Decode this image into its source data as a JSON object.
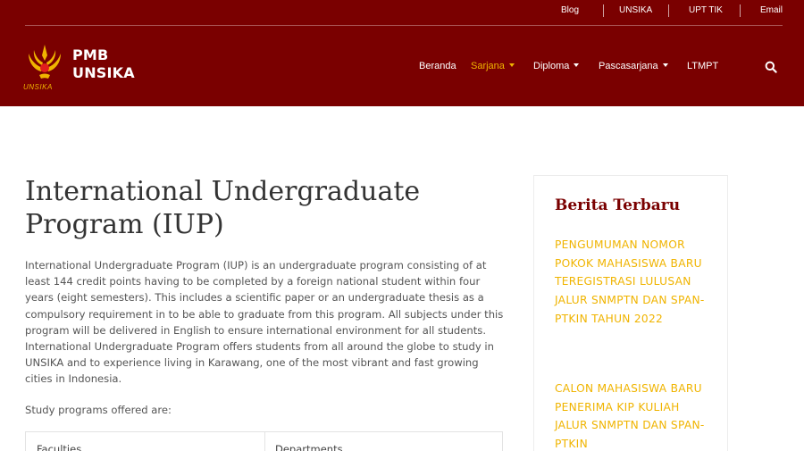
{
  "topbar": {
    "links": [
      "Blog",
      "UNSIKA",
      "UPT TIK",
      "Email"
    ]
  },
  "logo": {
    "line1": "PMB",
    "line2": "UNSIKA",
    "subtext": "UNSIKA"
  },
  "nav": {
    "items": [
      {
        "label": "Beranda",
        "dropdown": false,
        "active": false
      },
      {
        "label": "Sarjana",
        "dropdown": true,
        "active": true
      },
      {
        "label": "Diploma",
        "dropdown": true,
        "active": false
      },
      {
        "label": "Pascasarjana",
        "dropdown": true,
        "active": false
      },
      {
        "label": "LTMPT",
        "dropdown": false,
        "active": false
      }
    ],
    "search_icon": "search-icon"
  },
  "main": {
    "title": "International Undergraduate Program (IUP)",
    "intro": "International Undergraduate Program (IUP) is an undergraduate program consisting of at least 144 credit points having to be completed by a foreign national student within four years (eight semesters). This includes a scientific paper or an undergraduate thesis as a compulsory requirement in to be able to graduate from this program. All subjects under this program will be delivered in English to ensure international environment for all students. International Undergraduate Program offers students from all around the globe to study in UNSIKA and to experience living in Karawang, one of the most vibrant and fast growing cities in Indonesia.",
    "offered_label": "Study programs offered are:",
    "table_headers": [
      "Faculties",
      "Departments"
    ]
  },
  "sidebar": {
    "title": "Berita Terbaru",
    "news": [
      "PENGUMUMAN NOMOR POKOK MAHASISWA BARU TEREGISTRASI LULUSAN JALUR SNMPTN DAN SPAN-PTKIN TAHUN 2022",
      "CALON MAHASISWA BARU PENERIMA KIP KULIAH JALUR SNMPTN DAN SPAN-PTKIN"
    ]
  },
  "colors": {
    "header_bg": "#7a0000",
    "accent": "#f0b400",
    "sidebar_title": "#7a0000"
  }
}
